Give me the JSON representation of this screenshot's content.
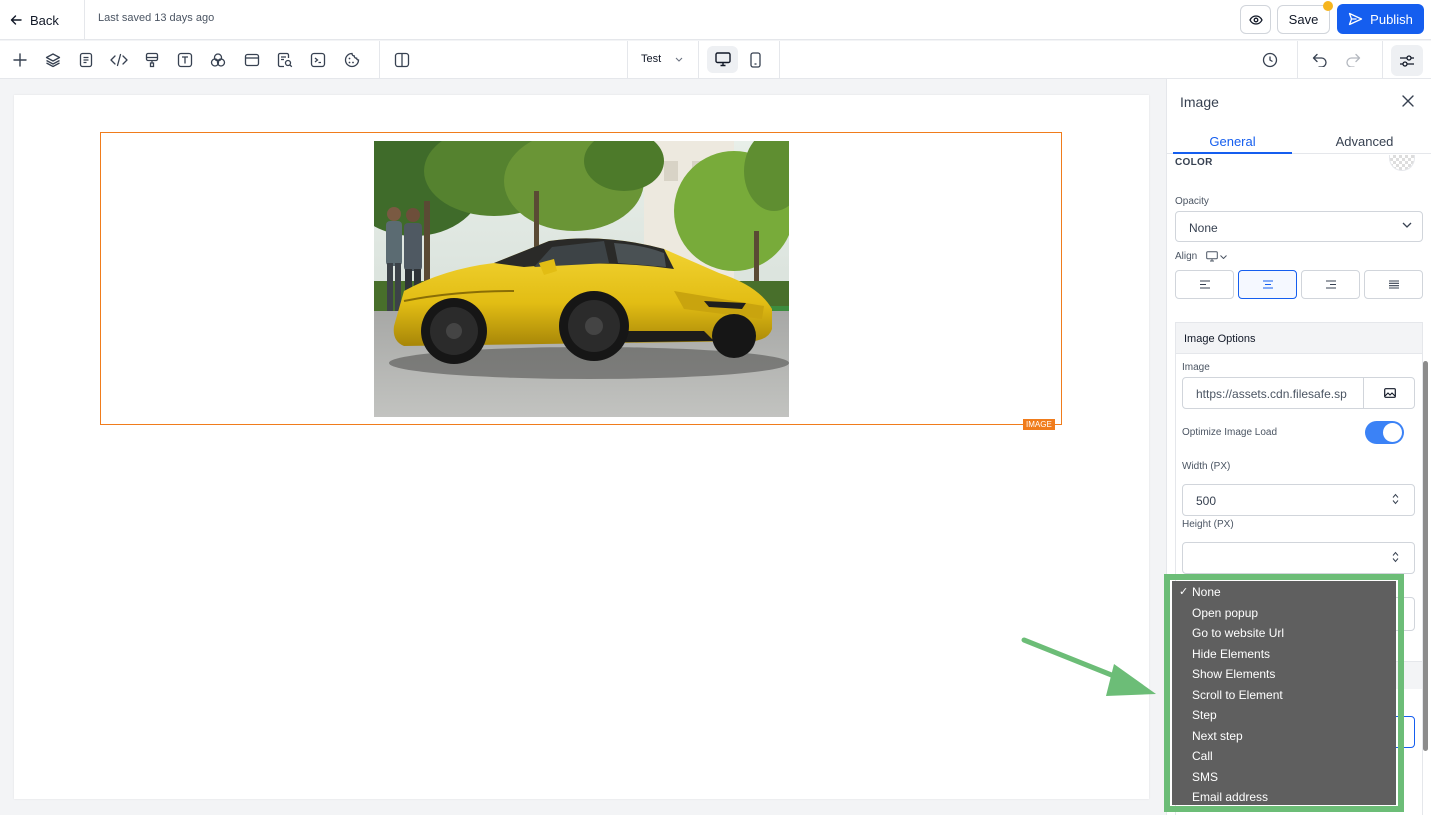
{
  "topbar": {
    "back_label": "Back",
    "last_saved": "Last saved 13 days ago",
    "save_label": "Save",
    "publish_label": "Publish"
  },
  "toolbar": {
    "tools": [
      "add-icon",
      "layers-icon",
      "page-icon",
      "code-icon",
      "paint-brush-icon",
      "text-icon",
      "shapes-icon",
      "browser-icon",
      "search-page-icon",
      "terminal-icon",
      "cookie-icon",
      "split-view-icon"
    ],
    "page_selector": "Test",
    "devices": [
      "desktop",
      "mobile"
    ],
    "active_device": "desktop"
  },
  "canvas": {
    "element_tag": "IMAGE",
    "image_alt": "Yellow sports car parked on a street"
  },
  "panel": {
    "title": "Image",
    "tabs": [
      {
        "label": "General",
        "active": true
      },
      {
        "label": "Advanced",
        "active": false
      }
    ],
    "color_label": "COLOR",
    "opacity_label": "Opacity",
    "opacity_value": "None",
    "align_label": "Align",
    "align_options": [
      "left",
      "center",
      "right",
      "justify"
    ],
    "align_selected": "center",
    "image_options": {
      "header": "Image Options",
      "image_label": "Image",
      "image_url": "https://assets.cdn.filesafe.sp",
      "optimize_label": "Optimize Image Load",
      "optimize_on": true,
      "width_label": "Width (PX)",
      "width_value": "500",
      "height_label": "Height (PX)",
      "height_value": ""
    }
  },
  "dropdown": {
    "selected": "None",
    "options": [
      "None",
      "Open popup",
      "Go to website Url",
      "Hide Elements",
      "Show Elements",
      "Scroll to Element",
      "Step",
      "Next step",
      "Call",
      "SMS",
      "Email address"
    ]
  },
  "colors": {
    "accent": "#155eef",
    "selection_border": "#f07c1c",
    "highlight_green": "#6cbd77",
    "toggle_on": "#3b82f6"
  }
}
